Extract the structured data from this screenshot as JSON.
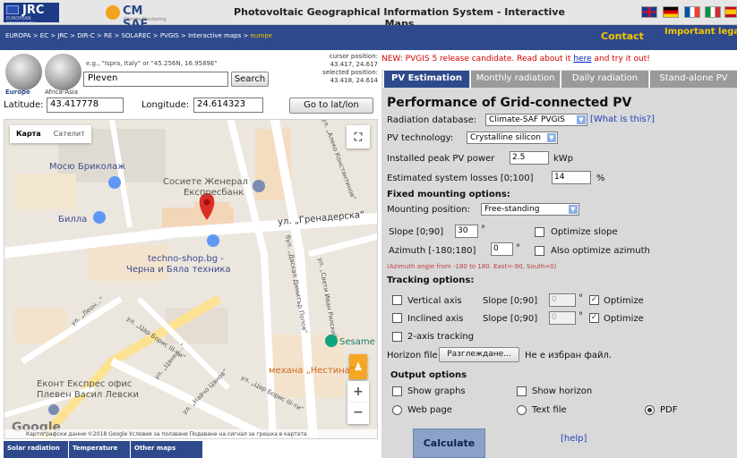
{
  "header": {
    "jrc_logo": "JRC",
    "jrc_subtitle": "EUROPEAN COMMISSION",
    "cmsaf_logo": "CM SAF",
    "cmsaf_subtitle": "Climate Monitoring",
    "title": "Photovoltaic Geographical Information System - Interactive Maps",
    "flags": [
      "uk-flag",
      "de-flag",
      "fr-flag",
      "it-flag",
      "es-flag"
    ]
  },
  "nav": {
    "breadcrumb": "EUROPA > EC > JRC > DIR-C > RE > SOLAREC > PVGIS > Interactive maps > ",
    "breadcrumb_current": "europe",
    "contact": "Contact",
    "legal": "Important legal notice"
  },
  "search": {
    "region_europe": "Europe",
    "region_africa": "Africa-Asia",
    "hint": "e.g., \"Ispra, Italy\" or \"45.256N, 16.9589E\"",
    "place_value": "Pleven",
    "search_button": "Search",
    "cursor_label": "cursor position:",
    "cursor_value": "43.417, 24.617",
    "selected_label": "selected position:",
    "selected_value": "43.418, 24.614",
    "lat_label": "Latitude:",
    "lat_value": "43.417778",
    "lon_label": "Longitude:",
    "lon_value": "24.614323",
    "goto_button": "Go to lat/lon"
  },
  "map": {
    "type_map": "Карта",
    "type_satellite": "Сателит",
    "poi": {
      "mosio": "Мосю Бриколаж",
      "societe": "Сосиете Женерал",
      "societe2": "Експресбанк",
      "billa": "Билла",
      "techno1": "techno-shop.bg -",
      "techno2": "Черна и Бяла техника",
      "sesame": "Sesame",
      "mehana": "механа „Нестина“",
      "ekont1": "Еконт Експрес офис",
      "ekont2": "Плевен Васил Левски"
    },
    "streets": {
      "grenaderska": "ул. „Гренадерска“",
      "aleko": "ул. „Алеко Константинов“",
      "daskal": "бул. „Даскал Димитър Попов“",
      "sveti": "ул. „Свети Иван Рилски“",
      "tsar1": "ул. „Цар Борис III-ти“",
      "tsar2": "ул. „Цар Борис III-ти“",
      "leon": "ул. „Леон...“",
      "tsanko": "ул. „Цанко...“",
      "nayo": "ул. „Найчо Цанов“"
    },
    "attribution": "Картографски данни ©2018 Google   Условия за ползване   Подаване на сигнал за грешка в картата",
    "google": "Google",
    "zoom_in": "+",
    "zoom_out": "−"
  },
  "map_tabs": [
    "Solar radiation",
    "Temperature",
    "Other maps"
  ],
  "notice": {
    "before": "NEW: PVGIS 5 release candidate. Read about it ",
    "link": "here",
    "after": " and try it out!"
  },
  "tabs": [
    "PV Estimation",
    "Monthly radiation",
    "Daily radiation",
    "Stand-alone PV"
  ],
  "form": {
    "heading": "Performance of Grid-connected PV",
    "radiation_db_label": "Radiation database:",
    "radiation_db_value": "Climate-SAF PVGIS",
    "what_is_this": "[What is this?]",
    "pv_tech_label": "PV technology:",
    "pv_tech_value": "Crystalline silicon",
    "peak_power_label": "Installed peak PV power",
    "peak_power_value": "2.5",
    "peak_power_unit": "kWp",
    "losses_label": "Estimated system losses [0;100]",
    "losses_value": "14",
    "losses_unit": "%",
    "fixed_heading": "Fixed mounting options:",
    "mounting_label": "Mounting position:",
    "mounting_value": "Free-standing",
    "slope_label": "Slope [0;90]",
    "slope_value": "30",
    "deg": "°",
    "optimize_slope": "Optimize slope",
    "azimuth_label": "Azimuth [-180;180]",
    "azimuth_value": "0",
    "optimize_azimuth": "Also optimize azimuth",
    "azimuth_note": "(Azimuth angle from -180 to 180. East=-90, South=0)",
    "tracking_heading": "Tracking options:",
    "vertical_axis": "Vertical axis",
    "inclined_axis": "Inclined axis",
    "track_slope_label": "Slope [0;90]",
    "track_slope_value": "0",
    "optimize": "Optimize",
    "two_axis": "2-axis tracking",
    "horizon_label": "Horizon file",
    "browse_button": "Разглеждане...",
    "no_file": "Не е избран файл.",
    "output_heading": "Output options",
    "show_graphs": "Show graphs",
    "show_horizon": "Show horizon",
    "web_page": "Web page",
    "text_file": "Text file",
    "pdf": "PDF",
    "calculate": "Calculate",
    "help": "[help]"
  }
}
